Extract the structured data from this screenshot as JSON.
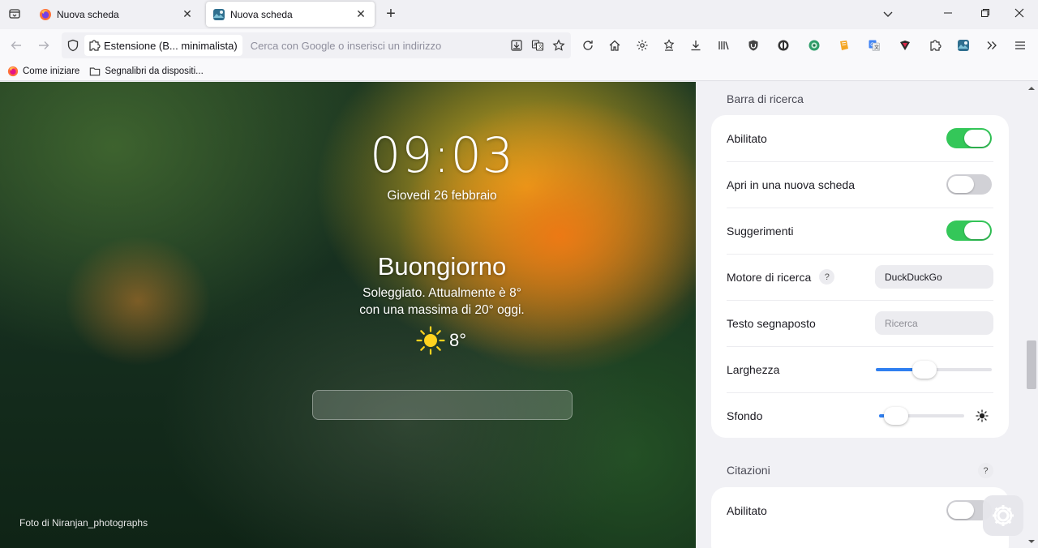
{
  "tabs": [
    {
      "title": "Nuova scheda",
      "active": false,
      "favicon": "firefox-icon"
    },
    {
      "title": "Nuova scheda",
      "active": true,
      "favicon": "extension-photo-icon"
    }
  ],
  "navbar": {
    "identity_label": "Estensione (B... minimalista)",
    "url_placeholder": "Cerca con Google o inserisci un indirizzo"
  },
  "bookmarks": [
    {
      "label": "Come iniziare",
      "icon": "firefox-icon"
    },
    {
      "label": "Segnalibri da dispositi...",
      "icon": "folder-icon"
    }
  ],
  "newtab": {
    "time": "09:03",
    "date": "Giovedì 26 febbraio",
    "greeting": "Buongiorno",
    "weather_line1": "Soleggiato. Attualmente è 8°",
    "weather_line2": "con una massima di 20° oggi.",
    "temperature": "8°",
    "weather_icon": "sun-icon",
    "photo_credit": "Foto di Niranjan_photographs"
  },
  "settings": {
    "search_section_title": "Barra di ricerca",
    "search_rows": {
      "enabled": {
        "label": "Abilitato",
        "value": true
      },
      "new_tab": {
        "label": "Apri in una nuova scheda",
        "value": false
      },
      "suggestions": {
        "label": "Suggerimenti",
        "value": true
      },
      "engine": {
        "label": "Motore di ricerca",
        "help": "?",
        "value": "DuckDuckGo"
      },
      "placeholder": {
        "label": "Testo segnaposto",
        "value": "Ricerca"
      },
      "width": {
        "label": "Larghezza",
        "value": 0.42
      },
      "background": {
        "label": "Sfondo",
        "value": 0.2
      }
    },
    "quotes_section_title": "Citazioni",
    "quotes_help": "?",
    "quotes_rows": {
      "enabled": {
        "label": "Abilitato",
        "value": false
      }
    }
  },
  "colors": {
    "toggle_on": "#34c759",
    "toggle_off": "#d1d1d6",
    "slider_fill": "#2f7ff0"
  }
}
